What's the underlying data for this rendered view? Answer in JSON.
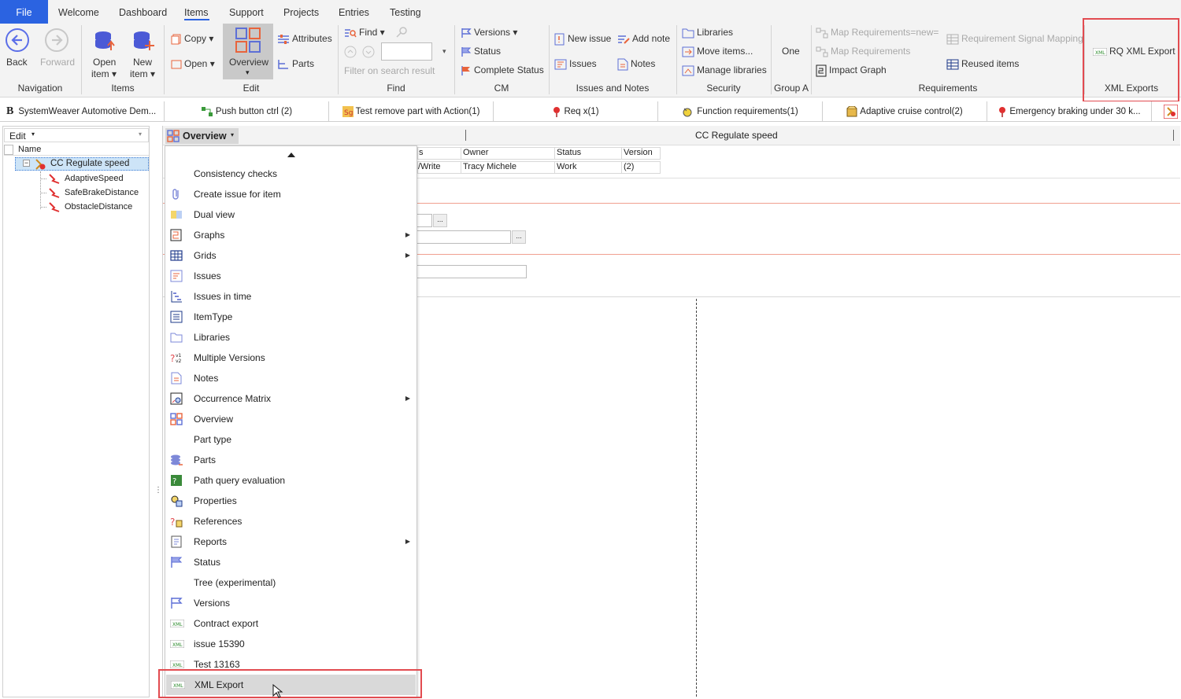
{
  "menubar": {
    "file": "File",
    "tabs": [
      "Welcome",
      "Dashboard",
      "Items",
      "Support",
      "Projects",
      "Entries",
      "Testing"
    ]
  },
  "ribbon": {
    "navigation": {
      "back": "Back",
      "forward": "Forward",
      "label": "Navigation"
    },
    "items": {
      "open_item": "Open",
      "open_item2": "item",
      "new_item": "New",
      "new_item2": "item",
      "label": "Items"
    },
    "edit": {
      "copy": "Copy",
      "open": "Open",
      "overview": "Overview",
      "attributes": "Attributes",
      "parts": "Parts",
      "label": "Edit"
    },
    "find": {
      "find": "Find",
      "filter": "Filter on search result",
      "label": "Find"
    },
    "cm": {
      "versions": "Versions",
      "status": "Status",
      "complete_status": "Complete Status",
      "label": "CM"
    },
    "issues_notes": {
      "new_issue": "New issue",
      "add_note": "Add note",
      "issues": "Issues",
      "notes": "Notes",
      "label": "Issues and Notes"
    },
    "security": {
      "libraries": "Libraries",
      "move_items": "Move items...",
      "manage_libraries": "Manage libraries",
      "label": "Security"
    },
    "group_a": {
      "one": "One",
      "label": "Group A"
    },
    "requirements": {
      "map_new": "Map Requirements=new=",
      "map": "Map Requirements",
      "impact_graph": "Impact Graph",
      "signal_mapping": "Requirement Signal Mapping",
      "reused_items": "Reused items",
      "label": "Requirements"
    },
    "xml_exports": {
      "rq_xml_export": "RQ XML Export",
      "label": "XML Exports"
    }
  },
  "doc_tabs": [
    "SystemWeaver Automotive Dem...",
    "Push button ctrl (2)",
    "Test remove part with Action(1)",
    "Req x(1)",
    "Function requirements(1)",
    "Adaptive cruise control(2)",
    "Emergency braking under 30 k..."
  ],
  "left_panel": {
    "edit": "Edit",
    "column_name": "Name",
    "tree": {
      "root": "CC Regulate speed",
      "children": [
        "AdaptiveSpeed",
        "SafeBrakeDistance",
        "ObstacleDistance"
      ]
    }
  },
  "main": {
    "view_button": "Overview",
    "title": "CC Regulate speed",
    "grid": {
      "headers": [
        "s",
        "Owner",
        "Status",
        "Version"
      ],
      "row": [
        "/Write",
        "Tracy Michele",
        "Work",
        "(2)"
      ]
    },
    "ellipsis": "..."
  },
  "dropdown": {
    "items": [
      {
        "label": "Consistency checks",
        "icon": "none",
        "submenu": false
      },
      {
        "label": "Create issue for item",
        "icon": "paperclip-icon",
        "submenu": false
      },
      {
        "label": "Dual view",
        "icon": "dual-view-icon",
        "submenu": false
      },
      {
        "label": "Graphs",
        "icon": "graph-icon",
        "submenu": true
      },
      {
        "label": "Grids",
        "icon": "grid-icon",
        "submenu": true
      },
      {
        "label": "Issues",
        "icon": "issues-icon",
        "submenu": false
      },
      {
        "label": "Issues in time",
        "icon": "timeline-icon",
        "submenu": false
      },
      {
        "label": "ItemType",
        "icon": "itemtype-icon",
        "submenu": false
      },
      {
        "label": "Libraries",
        "icon": "folder-icon",
        "submenu": false
      },
      {
        "label": "Multiple Versions",
        "icon": "versions-icon",
        "submenu": false
      },
      {
        "label": "Notes",
        "icon": "note-icon",
        "submenu": false
      },
      {
        "label": "Occurrence Matrix",
        "icon": "matrix-icon",
        "submenu": true
      },
      {
        "label": "Overview",
        "icon": "overview-icon",
        "submenu": false
      },
      {
        "label": "Part type",
        "icon": "none",
        "submenu": false
      },
      {
        "label": "Parts",
        "icon": "parts-icon",
        "submenu": false
      },
      {
        "label": "Path query evaluation",
        "icon": "query-icon",
        "submenu": false
      },
      {
        "label": "Properties",
        "icon": "properties-icon",
        "submenu": false
      },
      {
        "label": "References",
        "icon": "references-icon",
        "submenu": false
      },
      {
        "label": "Reports",
        "icon": "report-icon",
        "submenu": true
      },
      {
        "label": "Status",
        "icon": "flag-icon",
        "submenu": false
      },
      {
        "label": "Tree (experimental)",
        "icon": "none",
        "submenu": false
      },
      {
        "label": "Versions",
        "icon": "flag-outline-icon",
        "submenu": false
      },
      {
        "label": "Contract export",
        "icon": "xml-icon",
        "submenu": false
      },
      {
        "label": "issue 15390",
        "icon": "xml-icon",
        "submenu": false
      },
      {
        "label": "Test 13163",
        "icon": "xml-icon",
        "submenu": false
      },
      {
        "label": "XML Export",
        "icon": "xml-icon",
        "submenu": false
      }
    ]
  },
  "colors": {
    "accent": "#2b63e1",
    "highlight": "#e24b50",
    "selected": "#cde4f7"
  }
}
